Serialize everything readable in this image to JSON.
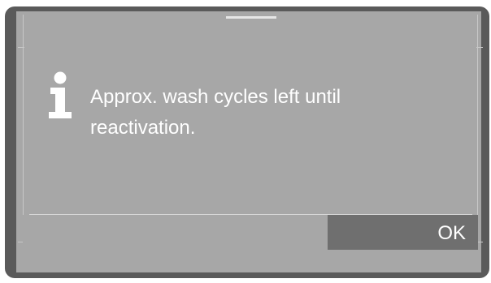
{
  "dialog": {
    "message": "Approx.  wash cycles left until\nreactivation."
  },
  "buttons": {
    "ok_label": "OK"
  },
  "icons": {
    "info": "info-icon"
  },
  "colors": {
    "screen_background": "#a7a7a7",
    "frame": "#5a5a5a",
    "button_background": "#6f6f6f",
    "text": "#ffffff"
  }
}
